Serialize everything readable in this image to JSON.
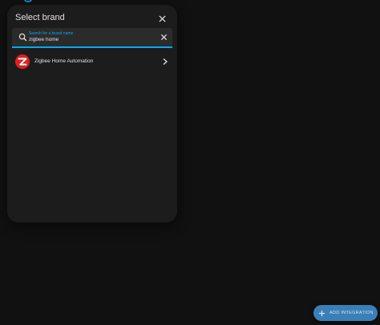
{
  "dialog": {
    "title": "Select brand"
  },
  "search": {
    "label": "Search for a brand name",
    "value": "zigbee home"
  },
  "results": [
    {
      "label": "Zigbee Home Automation",
      "icon": "zigbee-logo"
    }
  ],
  "fab": {
    "label": "ADD INTEGRATION"
  },
  "colors": {
    "accent": "#03a9f4",
    "fab": "#3a7fb8",
    "zigbee_red": "#e02020",
    "dialog_bg": "#1c1c1c",
    "page_bg": "#111111"
  }
}
